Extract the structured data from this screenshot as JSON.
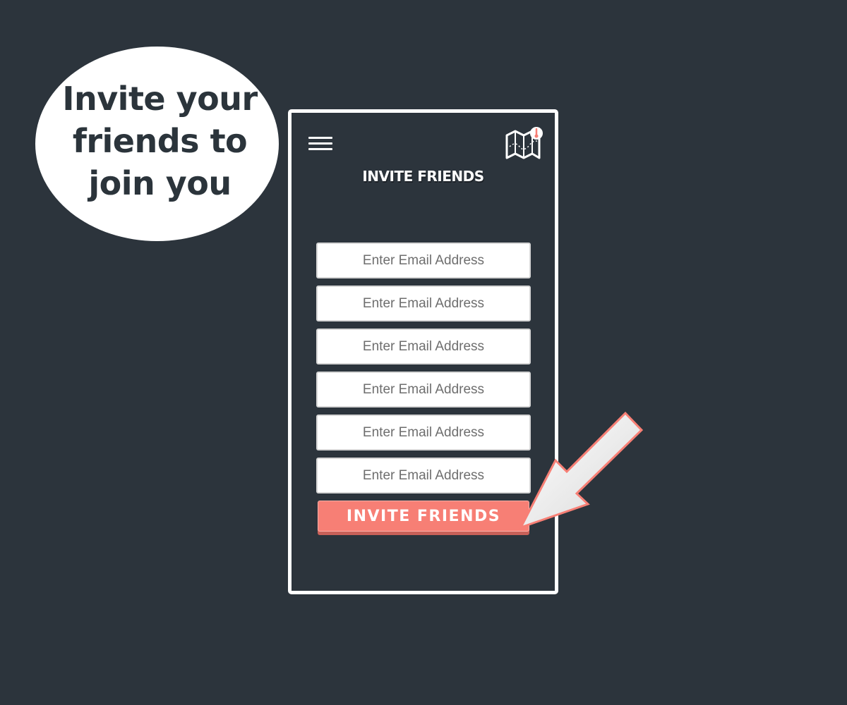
{
  "callout": {
    "lines": [
      "Invite your",
      "friends to",
      "join you"
    ]
  },
  "header": {
    "menu_icon": "hamburger-menu-icon",
    "logo_icon": "map-pin-logo-icon",
    "title": "INVITE FRIENDS"
  },
  "form": {
    "fields": [
      {
        "placeholder": "Enter Email Address",
        "value": ""
      },
      {
        "placeholder": "Enter Email Address",
        "value": ""
      },
      {
        "placeholder": "Enter Email Address",
        "value": ""
      },
      {
        "placeholder": "Enter Email Address",
        "value": ""
      },
      {
        "placeholder": "Enter Email Address",
        "value": ""
      },
      {
        "placeholder": "Enter Email Address",
        "value": ""
      }
    ],
    "submit_label": "INVITE FRIENDS"
  },
  "annotation": {
    "icon": "pointer-arrow-icon"
  },
  "colors": {
    "background": "#2c343c",
    "accent": "#f77f75",
    "bubble": "#ffffff",
    "text_dark": "#2b343b"
  }
}
